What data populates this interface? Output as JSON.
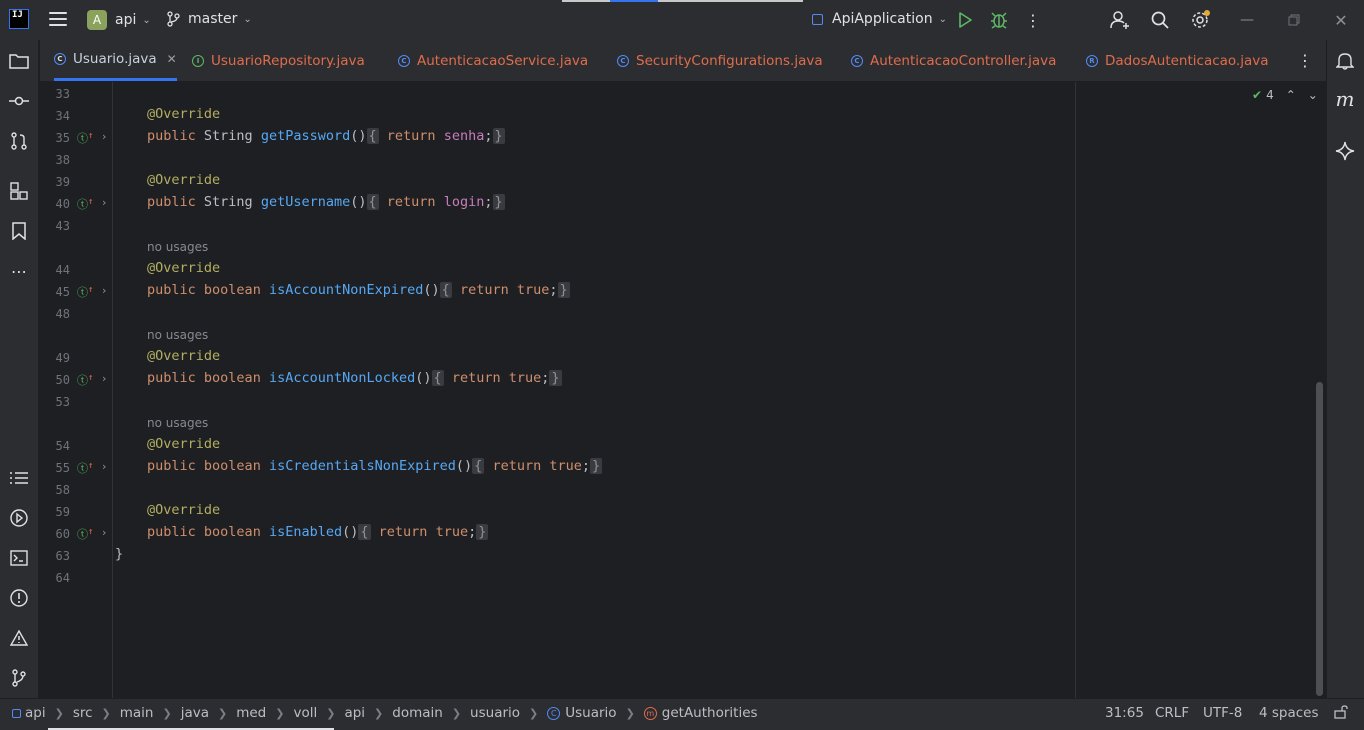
{
  "titlebar": {
    "ide_logo": "IJ",
    "project_badge": "A",
    "project_name": "api",
    "branch": "master",
    "run_config": "ApiApplication"
  },
  "tabs": [
    {
      "label": "Usuario.java",
      "icon": "C",
      "color": "#c9d1e0",
      "active": true
    },
    {
      "label": "UsuarioRepository.java",
      "icon": "I",
      "color": "#e06c4c"
    },
    {
      "label": "AutenticacaoService.java",
      "icon": "C",
      "color": "#e06c4c"
    },
    {
      "label": "SecurityConfigurations.java",
      "icon": "C",
      "color": "#e06c4c"
    },
    {
      "label": "AutenticacaoController.java",
      "icon": "C",
      "color": "#e06c4c"
    },
    {
      "label": "DadosAutenticacao.java",
      "icon": "R",
      "color": "#e06c4c"
    }
  ],
  "inspections": {
    "count": "4"
  },
  "editor": {
    "line_numbers": [
      "33",
      "34",
      "35",
      "38",
      "39",
      "40",
      "43",
      "44",
      "45",
      "48",
      "49",
      "50",
      "53",
      "54",
      "55",
      "58",
      "59",
      "60",
      "63",
      "64"
    ],
    "hints": [
      "no usages",
      "no usages",
      "no usages"
    ],
    "annotation": "@Override",
    "closing_brace": "}",
    "methods": [
      {
        "kw": "public",
        "type": "String",
        "name": "getPassword",
        "body_kw": "return",
        "body_val": "senha",
        "val_kind": "field"
      },
      {
        "kw": "public",
        "type": "String",
        "name": "getUsername",
        "body_kw": "return",
        "body_val": "login",
        "val_kind": "field"
      },
      {
        "kw": "public",
        "type": "boolean",
        "name": "isAccountNonExpired",
        "body_kw": "return",
        "body_val": "true",
        "val_kind": "keyword"
      },
      {
        "kw": "public",
        "type": "boolean",
        "name": "isAccountNonLocked",
        "body_kw": "return",
        "body_val": "true",
        "val_kind": "keyword"
      },
      {
        "kw": "public",
        "type": "boolean",
        "name": "isCredentialsNonExpired",
        "body_kw": "return",
        "body_val": "true",
        "val_kind": "keyword"
      },
      {
        "kw": "public",
        "type": "boolean",
        "name": "isEnabled",
        "body_kw": "return",
        "body_val": "true",
        "val_kind": "keyword"
      }
    ]
  },
  "breadcrumb": [
    "api",
    "src",
    "main",
    "java",
    "med",
    "voll",
    "api",
    "domain",
    "usuario",
    "Usuario",
    "getAuthorities"
  ],
  "status": {
    "position": "31:65",
    "line_sep": "CRLF",
    "encoding": "UTF-8",
    "indent": "4 spaces"
  }
}
